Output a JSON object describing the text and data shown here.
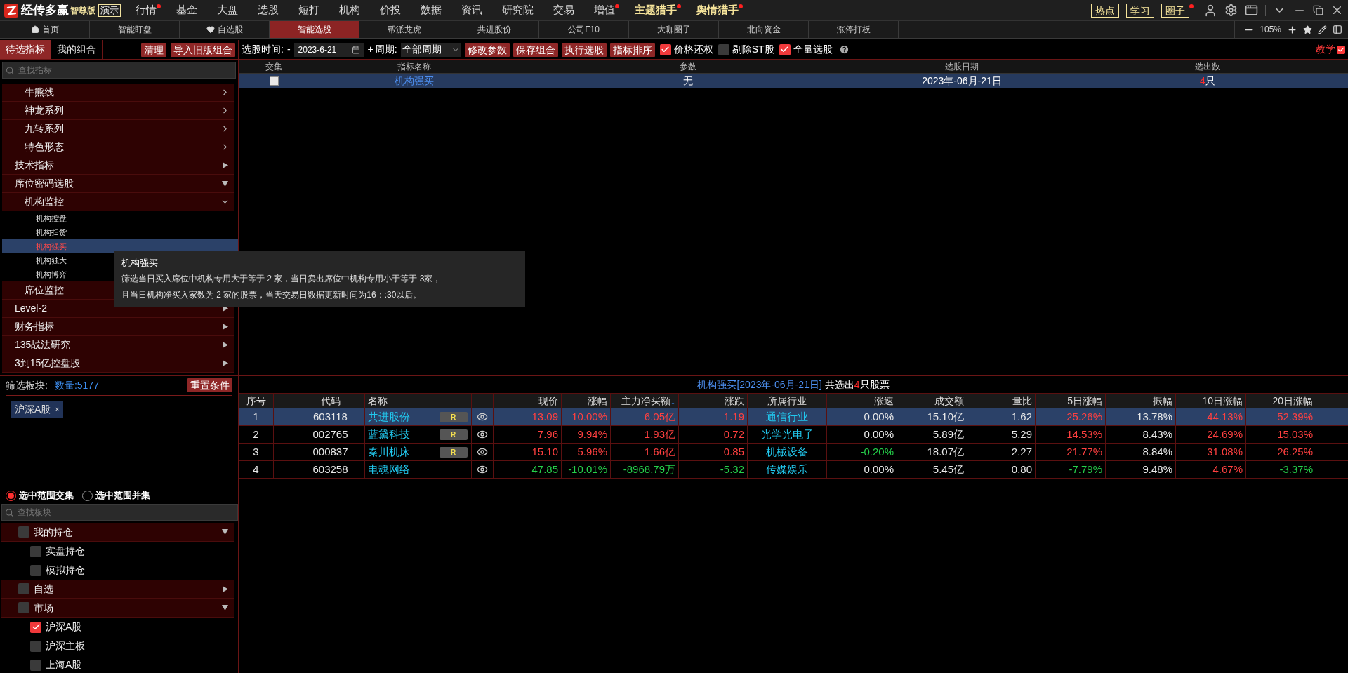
{
  "app": {
    "brand": "经传多赢",
    "edition": "智尊版",
    "mode_badge": "演示"
  },
  "menu": [
    {
      "label": "行情",
      "dot": true,
      "highlight": false
    },
    {
      "label": "基金",
      "dot": false,
      "highlight": false
    },
    {
      "label": "大盘",
      "dot": false,
      "highlight": false
    },
    {
      "label": "选股",
      "dot": false,
      "highlight": false
    },
    {
      "label": "短打",
      "dot": false,
      "highlight": false
    },
    {
      "label": "机构",
      "dot": false,
      "highlight": false
    },
    {
      "label": "价投",
      "dot": false,
      "highlight": false
    },
    {
      "label": "数据",
      "dot": false,
      "highlight": false
    },
    {
      "label": "资讯",
      "dot": false,
      "highlight": false
    },
    {
      "label": "研究院",
      "dot": false,
      "highlight": false
    },
    {
      "label": "交易",
      "dot": false,
      "highlight": false
    },
    {
      "label": "增值",
      "dot": true,
      "highlight": false
    },
    {
      "label": "主题猎手",
      "dot": true,
      "highlight": true
    },
    {
      "label": "舆情猎手",
      "dot": true,
      "highlight": true
    }
  ],
  "quick_links": [
    {
      "label": "热点",
      "dot": false
    },
    {
      "label": "学习",
      "dot": false
    },
    {
      "label": "圈子",
      "dot": true
    }
  ],
  "tabs": [
    {
      "label": "首页",
      "selected": false
    },
    {
      "label": "智能盯盘",
      "selected": false
    },
    {
      "label": "自选股",
      "selected": false
    },
    {
      "label": "智能选股",
      "selected": true
    },
    {
      "label": "帮派龙虎",
      "selected": false
    },
    {
      "label": "共进股份",
      "selected": false
    },
    {
      "label": "公司F10",
      "selected": false
    },
    {
      "label": "大咖圈子",
      "selected": false
    },
    {
      "label": "北向资金",
      "selected": false
    },
    {
      "label": "涨停打板",
      "selected": false
    }
  ],
  "zoom_level": "105%",
  "left_tabs": [
    {
      "label": "待选指标",
      "selected": true
    },
    {
      "label": "我的组合",
      "selected": false
    }
  ],
  "left_buttons": [
    "清理",
    "导入旧版组合"
  ],
  "toolbar": {
    "date_label": "选股时间:",
    "date_minus": "-",
    "date_value": "2023-6-21",
    "date_plus": "+",
    "period_label": "周期:",
    "period_value": "全部周期",
    "buttons": [
      "修改参数",
      "保存组合",
      "执行选股",
      "指标排序"
    ],
    "options": [
      {
        "label": "价格还权",
        "checked": true
      },
      {
        "label": "剔除ST股",
        "checked": false
      },
      {
        "label": "全量选股",
        "checked": true
      }
    ],
    "tutorial": "教学"
  },
  "indicator_search": {
    "placeholder": "查找指标"
  },
  "indicator_tree": {
    "continued": [
      {
        "label": "牛熊线",
        "expanded": false
      },
      {
        "label": "神龙系列",
        "expanded": false
      },
      {
        "label": "九转系列",
        "expanded": false
      },
      {
        "label": "特色形态",
        "expanded": false
      }
    ],
    "items": [
      {
        "label": "技术指标",
        "expanded": false
      },
      {
        "label": "席位密码选股",
        "expanded": true,
        "children": [
          {
            "label": "机构监控",
            "expanded": true,
            "children": [
              {
                "label": "机构控盘",
                "selected": false
              },
              {
                "label": "机构扫货",
                "selected": false
              },
              {
                "label": "机构强买",
                "selected": true
              },
              {
                "label": "机构独大",
                "selected": false
              },
              {
                "label": "机构博弈",
                "selected": false
              }
            ]
          },
          {
            "label": "席位监控"
          }
        ]
      },
      {
        "label": "Level-2",
        "expanded": false
      },
      {
        "label": "财务指标",
        "expanded": false
      },
      {
        "label": "135战法研究",
        "expanded": false
      },
      {
        "label": "3到15亿控盘股",
        "expanded": false
      }
    ]
  },
  "criteria_table": {
    "columns": [
      "交集",
      "指标名称",
      "参数",
      "选股日期",
      "选出数"
    ],
    "rows": [
      {
        "selected": true,
        "checked": false,
        "name": "机构强买",
        "params": "无",
        "date": "2023年-06月-21日",
        "count": "4",
        "unit": "只"
      }
    ]
  },
  "tooltip": {
    "title": "机构强买",
    "lines": [
      "筛选当日买入席位中机构专用大于等于 2 家，当日卖出席位中机构专用小于等于 3家，",
      "且当日机构净买入家数为 2 家的股票，当天交易日数据更新时间为16：:30以后。"
    ]
  },
  "filter": {
    "label": "筛选板块:",
    "count": "数量:5177",
    "reset_button": "重置条件",
    "tags": [
      {
        "label": "沪深A股",
        "remove": "×"
      }
    ],
    "modes": [
      {
        "label": "选中范围交集",
        "selected": true
      },
      {
        "label": "选中范围并集",
        "selected": false
      }
    ]
  },
  "block_search": {
    "placeholder": "查找板块"
  },
  "block_tree": [
    {
      "label": "我的持仓",
      "checked": false,
      "expanded": true,
      "children": [
        {
          "label": "实盘持仓",
          "checked": false
        },
        {
          "label": "模拟持仓",
          "checked": false
        }
      ]
    },
    {
      "label": "自选",
      "checked": false,
      "expanded": false
    },
    {
      "label": "市场",
      "checked": false,
      "expanded": true,
      "children": [
        {
          "label": "沪深A股",
          "checked": true
        },
        {
          "label": "沪深主板",
          "checked": false
        },
        {
          "label": "上海A股",
          "checked": false
        }
      ]
    }
  ],
  "results": {
    "title": "机构强买[2023年-06月-21日]",
    "summary_prefix": "共选出",
    "count": "4",
    "summary_suffix": "只股票",
    "columns": [
      {
        "label": "序号"
      },
      {
        "label": "代码"
      },
      {
        "label": "名称"
      },
      {
        "label": "现价"
      },
      {
        "label": "涨幅"
      },
      {
        "label": "主力净买额",
        "sort_mark": "↓"
      },
      {
        "label": "涨跌"
      },
      {
        "label": "所属行业"
      },
      {
        "label": "涨速"
      },
      {
        "label": "成交额"
      },
      {
        "label": "量比"
      },
      {
        "label": "5日涨幅"
      },
      {
        "label": "振幅"
      },
      {
        "label": "10日涨幅"
      },
      {
        "label": "20日涨幅"
      }
    ],
    "rows": [
      {
        "selected": true,
        "badge": "R",
        "cells": [
          {
            "text": "1",
            "color": "#e8e8e8"
          },
          {
            "text": "603118",
            "color": "#e8e8e8"
          },
          {
            "text": "共进股份",
            "color": "#22c8ee"
          },
          {
            "text": "13.09",
            "color": "#ff4040"
          },
          {
            "text": "10.00%",
            "color": "#ff4040"
          },
          {
            "text": "6.05亿",
            "color": "#ff4040"
          },
          {
            "text": "1.19",
            "color": "#ff4040"
          },
          {
            "text": "通信行业",
            "color": "#22c8ee"
          },
          {
            "text": "0.00%",
            "color": "#e8e8e8"
          },
          {
            "text": "15.10亿",
            "color": "#e8e8e8"
          },
          {
            "text": "1.62",
            "color": "#e8e8e8"
          },
          {
            "text": "25.26%",
            "color": "#ff4040"
          },
          {
            "text": "13.78%",
            "color": "#e8e8e8"
          },
          {
            "text": "44.13%",
            "color": "#ff4040"
          },
          {
            "text": "52.39%",
            "color": "#ff4040"
          }
        ]
      },
      {
        "selected": false,
        "badge": "R",
        "cells": [
          {
            "text": "2",
            "color": "#e8e8e8"
          },
          {
            "text": "002765",
            "color": "#e8e8e8"
          },
          {
            "text": "蓝黛科技",
            "color": "#22c8ee"
          },
          {
            "text": "7.96",
            "color": "#ff4040"
          },
          {
            "text": "9.94%",
            "color": "#ff4040"
          },
          {
            "text": "1.93亿",
            "color": "#ff4040"
          },
          {
            "text": "0.72",
            "color": "#ff4040"
          },
          {
            "text": "光学光电子",
            "color": "#22c8ee"
          },
          {
            "text": "0.00%",
            "color": "#e8e8e8"
          },
          {
            "text": "5.89亿",
            "color": "#e8e8e8"
          },
          {
            "text": "5.29",
            "color": "#e8e8e8"
          },
          {
            "text": "14.53%",
            "color": "#ff4040"
          },
          {
            "text": "8.43%",
            "color": "#e8e8e8"
          },
          {
            "text": "24.69%",
            "color": "#ff4040"
          },
          {
            "text": "15.03%",
            "color": "#ff4040"
          }
        ]
      },
      {
        "selected": false,
        "badge": "R",
        "cells": [
          {
            "text": "3",
            "color": "#e8e8e8"
          },
          {
            "text": "000837",
            "color": "#e8e8e8"
          },
          {
            "text": "秦川机床",
            "color": "#22c8ee"
          },
          {
            "text": "15.10",
            "color": "#ff4040"
          },
          {
            "text": "5.96%",
            "color": "#ff4040"
          },
          {
            "text": "1.66亿",
            "color": "#ff4040"
          },
          {
            "text": "0.85",
            "color": "#ff4040"
          },
          {
            "text": "机械设备",
            "color": "#22c8ee"
          },
          {
            "text": "-0.20%",
            "color": "#25d04a"
          },
          {
            "text": "18.07亿",
            "color": "#e8e8e8"
          },
          {
            "text": "2.27",
            "color": "#e8e8e8"
          },
          {
            "text": "21.77%",
            "color": "#ff4040"
          },
          {
            "text": "8.84%",
            "color": "#e8e8e8"
          },
          {
            "text": "31.08%",
            "color": "#ff4040"
          },
          {
            "text": "26.25%",
            "color": "#ff4040"
          }
        ]
      },
      {
        "selected": false,
        "cells": [
          {
            "text": "4",
            "color": "#e8e8e8"
          },
          {
            "text": "603258",
            "color": "#e8e8e8"
          },
          {
            "text": "电魂网络",
            "color": "#22c8ee"
          },
          {
            "text": "47.85",
            "color": "#25d04a"
          },
          {
            "text": "-10.01%",
            "color": "#25d04a"
          },
          {
            "text": "-8968.79万",
            "color": "#25d04a"
          },
          {
            "text": "-5.32",
            "color": "#25d04a"
          },
          {
            "text": "传媒娱乐",
            "color": "#22c8ee"
          },
          {
            "text": "0.00%",
            "color": "#e8e8e8"
          },
          {
            "text": "5.45亿",
            "color": "#e8e8e8"
          },
          {
            "text": "0.80",
            "color": "#e8e8e8"
          },
          {
            "text": "-7.79%",
            "color": "#25d04a"
          },
          {
            "text": "9.48%",
            "color": "#e8e8e8"
          },
          {
            "text": "4.67%",
            "color": "#ff4040"
          },
          {
            "text": "-3.37%",
            "color": "#25d04a"
          }
        ]
      }
    ]
  }
}
